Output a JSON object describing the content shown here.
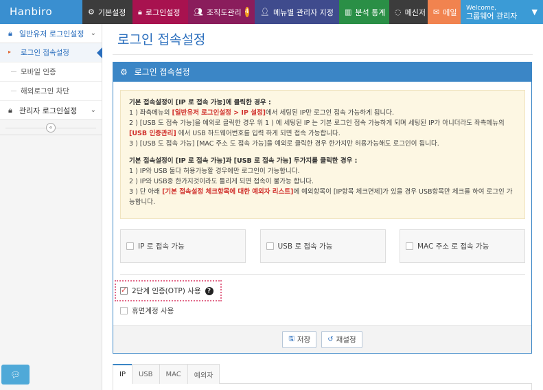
{
  "brand": "Hanbiro",
  "nav": {
    "basic": "기본설정",
    "login": "로그인설정",
    "org": "조직도관리",
    "org_badge": "4",
    "menu_admin": "메뉴별 관리자 지정",
    "stats": "분석 통계",
    "messenger": "메신저",
    "mail": "메일",
    "welcome": "Welcome,",
    "user": "그룹웨어 관리자"
  },
  "sidebar": {
    "group1": "일반유저 로그인설정",
    "items": [
      "로그인 접속설정",
      "모바일 인증",
      "해외로그인 차단"
    ],
    "group2": "관리자 로그인설정",
    "collapse_glyph": "«"
  },
  "page_title": "로그인 접속설정",
  "panel": {
    "title": "로그인 접속설정",
    "notice": {
      "h1": "기본 접속설정이 [IP 로 접속 가능]에 클릭한 경우 :",
      "l1a": "1 ) 좌측메뉴의 ",
      "l1b": "[일반유저 로그인설정 > IP 설정]",
      "l1c": "에서 세팅된 IP만 로그인 접속 가능하게 됩니다.",
      "l2a": "2 ) [USB 도 접속 가능]을 예외로 클릭한 경우 위 1 ) 에 세팅된 IP 는 기본 로그인 접속 가능하게 되며 세팅된 IP가 아니더라도 좌측메뉴의 ",
      "l2b": "[USB 인증관리]",
      "l2c": " 에서 USB 하드웨어번호를 입력 하게 되면 접속 가능합니다.",
      "l3": "3 ) [USB 도 접속 가능] [MAC 주소 도 접속 가능]을 예외로 클릭한 경우 한가지만 허용가능해도 로그인이 됩니다.",
      "h2": "기본 접속설정이 [IP 로 접속 가능]과 [USB 로 접속 가능] 두가지를 클릭한 경우 :",
      "m1": "1 ) IP와 USB 둘다 허용가능할 경우에만 로그인이 가능합니다.",
      "m2": "2 ) IP와 USB중 한가지것이라도 틀리게 되면 접속이 불가능 합니다.",
      "m3a": "3 ) 단 아래 ",
      "m3b": "[기본 접속설정 체크항목에 대한 예외자 리스트]",
      "m3c": "에 예외항목이 [IP항목 체크면제]가 있을 경우 USB항목만 체크를 하여 로그인 가능합니다."
    },
    "options": [
      "IP 로 접속 가능",
      "USB 로 접속 가능",
      "MAC 주소 로 접속 가능"
    ],
    "otp_label": "2단계 인증(OTP) 사용",
    "otp_checked": true,
    "dormant_label": "휴면계정 사용",
    "save_label": "저장",
    "reset_label": "재설정"
  },
  "tabs": [
    "IP",
    "USB",
    "MAC",
    "예외자"
  ]
}
